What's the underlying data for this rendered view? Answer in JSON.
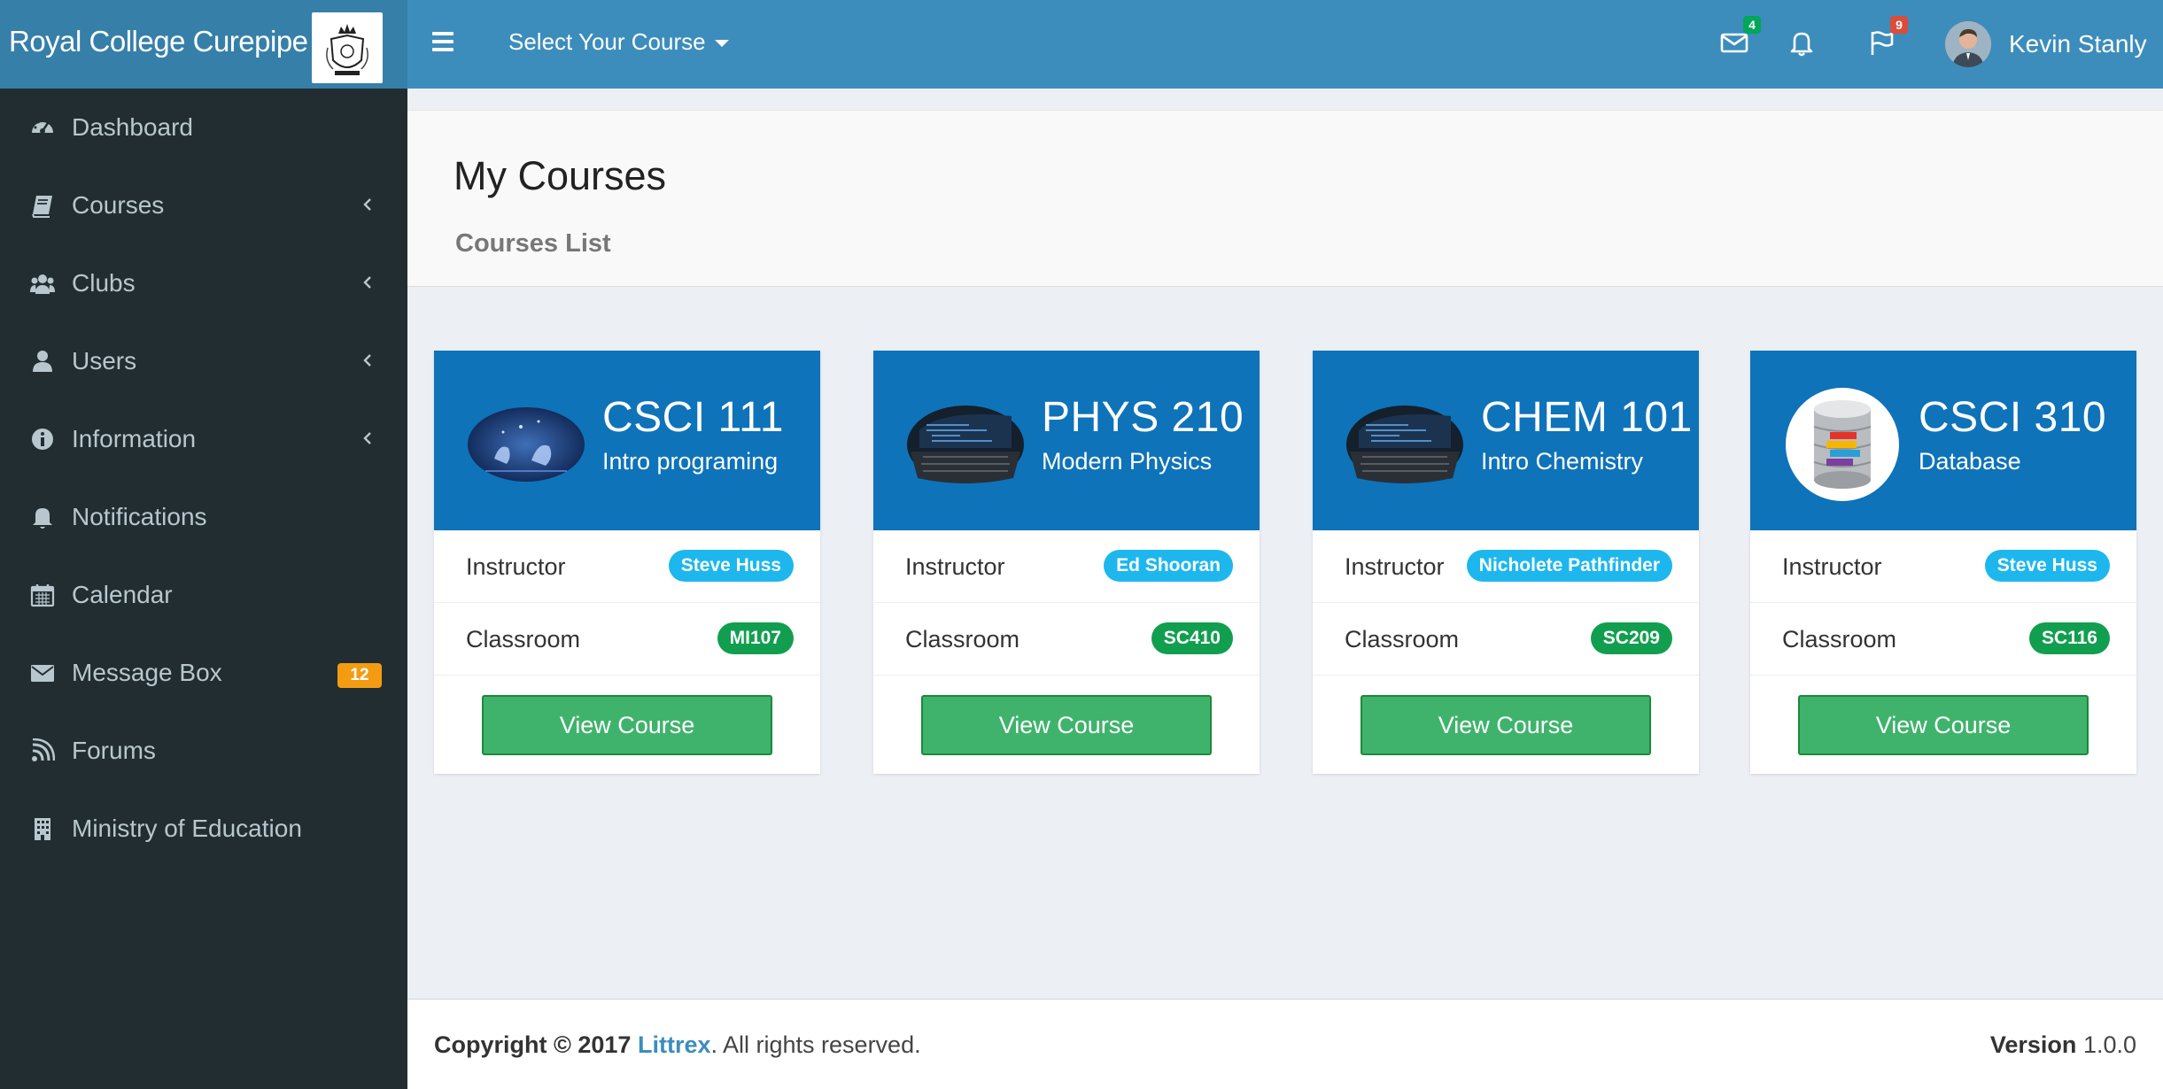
{
  "header": {
    "logo_text": "Royal College Curepipe",
    "course_select_label": "Select Your Course",
    "mail_count": "4",
    "notification_count": "",
    "flag_count": "9",
    "user_name": "Kevin Stanly",
    "colors": {
      "header_bg": "#3c8dbc",
      "logo_bg": "#367fa9"
    }
  },
  "sidebar": {
    "items": [
      {
        "label": "Dashboard",
        "icon": "dashboard-icon",
        "has_chevron": false
      },
      {
        "label": "Courses",
        "icon": "book-icon",
        "has_chevron": true
      },
      {
        "label": "Clubs",
        "icon": "users-group-icon",
        "has_chevron": true
      },
      {
        "label": "Users",
        "icon": "user-icon",
        "has_chevron": true
      },
      {
        "label": "Information",
        "icon": "info-icon",
        "has_chevron": true
      },
      {
        "label": "Notifications",
        "icon": "bell-icon",
        "has_chevron": false
      },
      {
        "label": "Calendar",
        "icon": "calendar-icon",
        "has_chevron": false
      },
      {
        "label": "Message Box",
        "icon": "envelope-icon",
        "badge": "12"
      },
      {
        "label": "Forums",
        "icon": "rss-icon",
        "has_chevron": false
      },
      {
        "label": "Ministry of Education",
        "icon": "building-icon",
        "has_chevron": false
      }
    ]
  },
  "content": {
    "title": "My Courses",
    "subtitle": "Courses List"
  },
  "courses": [
    {
      "code": "CSCI 111",
      "name": "Intro programing",
      "instructor_label": "Instructor",
      "instructor": "Steve Huss",
      "classroom_label": "Classroom",
      "classroom": "MI107",
      "button": "View Course",
      "image": "hands-keyboard-image"
    },
    {
      "code": "PHYS 210",
      "name": "Modern Physics",
      "instructor_label": "Instructor",
      "instructor": "Ed Shooran",
      "classroom_label": "Classroom",
      "classroom": "SC410",
      "button": "View Course",
      "image": "laptop-code-image"
    },
    {
      "code": "CHEM 101",
      "name": "Intro Chemistry",
      "instructor_label": "Instructor",
      "instructor": "Nicholete Pathfinder",
      "classroom_label": "Classroom",
      "classroom": "SC209",
      "button": "View Course",
      "image": "laptop-code-image"
    },
    {
      "code": "CSCI 310",
      "name": "Database",
      "instructor_label": "Instructor",
      "instructor": "Steve Huss",
      "classroom_label": "Classroom",
      "classroom": "SC116",
      "button": "View Course",
      "image": "database-cylinder-image"
    }
  ],
  "footer": {
    "copyright_prefix": "Copyright © 2017",
    "brand": "Littrex",
    "copyright_suffix": ". All rights reserved.",
    "version_label": "Version",
    "version": "1.0.0"
  }
}
